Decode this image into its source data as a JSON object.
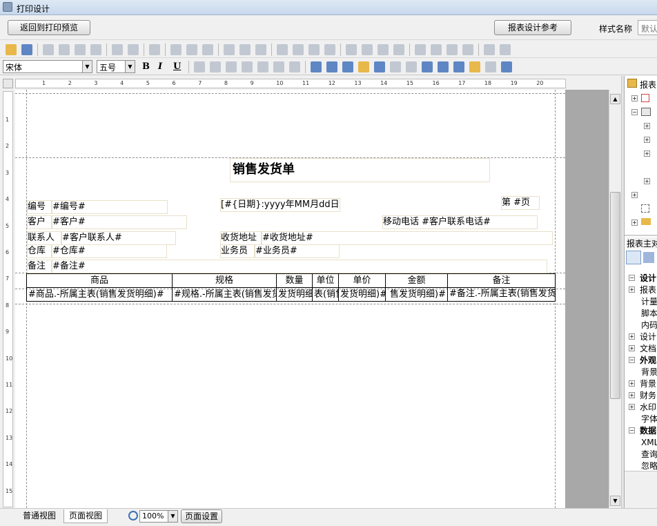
{
  "window": {
    "title": "打印设计"
  },
  "topbar": {
    "back_button": "返回到打印预览",
    "reference_button": "报表设计参考",
    "style_label": "样式名称",
    "style_value": "默认"
  },
  "format": {
    "font_name": "宋体",
    "font_size": "五号",
    "bold": "B",
    "italic": "I",
    "underline": "U"
  },
  "ruler": {
    "top": [
      "1",
      "2",
      "3",
      "4",
      "5",
      "6",
      "7",
      "8",
      "9",
      "10",
      "11",
      "12",
      "13",
      "14",
      "15",
      "16",
      "17",
      "18",
      "19",
      "20"
    ],
    "left": [
      "1",
      "2",
      "3",
      "4",
      "5",
      "6",
      "7",
      "8",
      "9",
      "10",
      "11",
      "12",
      "13",
      "14",
      "15"
    ]
  },
  "report": {
    "title": "销售发货单",
    "page_label": "第 #页",
    "date_field": "[#{日期}:yyyy年MM月dd日#]",
    "fields": {
      "no_label": "编号",
      "no_value": "#编号#",
      "customer_label": "客户",
      "customer_value": "#客户#",
      "mobile": "移动电话 #客户联系电话#",
      "contact_label": "联系人",
      "contact_value": "#客户联系人#",
      "address_label": "收货地址",
      "address_value": "#收货地址#",
      "warehouse_label": "仓库",
      "warehouse_value": "#仓库#",
      "salesman_label": "业务员",
      "salesman_value": "#业务员#",
      "remark_label": "备注",
      "remark_value": "#备注#"
    },
    "table": {
      "headers": [
        "商品",
        "规格",
        "数量",
        "单位",
        "单价",
        "金额",
        "备注"
      ],
      "row": [
        "#商品.-所属主表(销售发货明细)#",
        "#规格.-所属主表(销售发货明细)#",
        "发货明细)#",
        "表(销售发货明细)#",
        "发货明细)#",
        "售发货明细)#",
        "#备注.-所属主表(销售发货明细)#"
      ]
    }
  },
  "right_panel": {
    "tree_root": "报表",
    "props_title": "报表主对象",
    "props": [
      {
        "sign": "−",
        "text": "设计",
        "bold": true
      },
      {
        "sign": "+",
        "text": "报表",
        "bold": false
      },
      {
        "sign": "",
        "text": "计量",
        "bold": false
      },
      {
        "sign": "",
        "text": "脚本",
        "bold": false
      },
      {
        "sign": "",
        "text": "内码",
        "bold": false
      },
      {
        "sign": "+",
        "text": "设计",
        "bold": false
      },
      {
        "sign": "+",
        "text": "文档",
        "bold": false
      },
      {
        "sign": "−",
        "text": "外观",
        "bold": true
      },
      {
        "sign": "",
        "text": "背景",
        "bold": false
      },
      {
        "sign": "+",
        "text": "背景",
        "bold": false
      },
      {
        "sign": "+",
        "text": "财务",
        "bold": false
      },
      {
        "sign": "+",
        "text": "水印",
        "bold": false
      },
      {
        "sign": "",
        "text": "字体",
        "bold": false
      },
      {
        "sign": "−",
        "text": "数据",
        "bold": true
      },
      {
        "sign": "",
        "text": "XML表",
        "bold": false
      },
      {
        "sign": "",
        "text": "查询",
        "bold": false
      },
      {
        "sign": "",
        "text": "忽略",
        "bold": false
      }
    ]
  },
  "status": {
    "tab_normal": "普通视图",
    "tab_page": "页面视图",
    "zoom": "100%",
    "page_setup": "页面设置"
  }
}
